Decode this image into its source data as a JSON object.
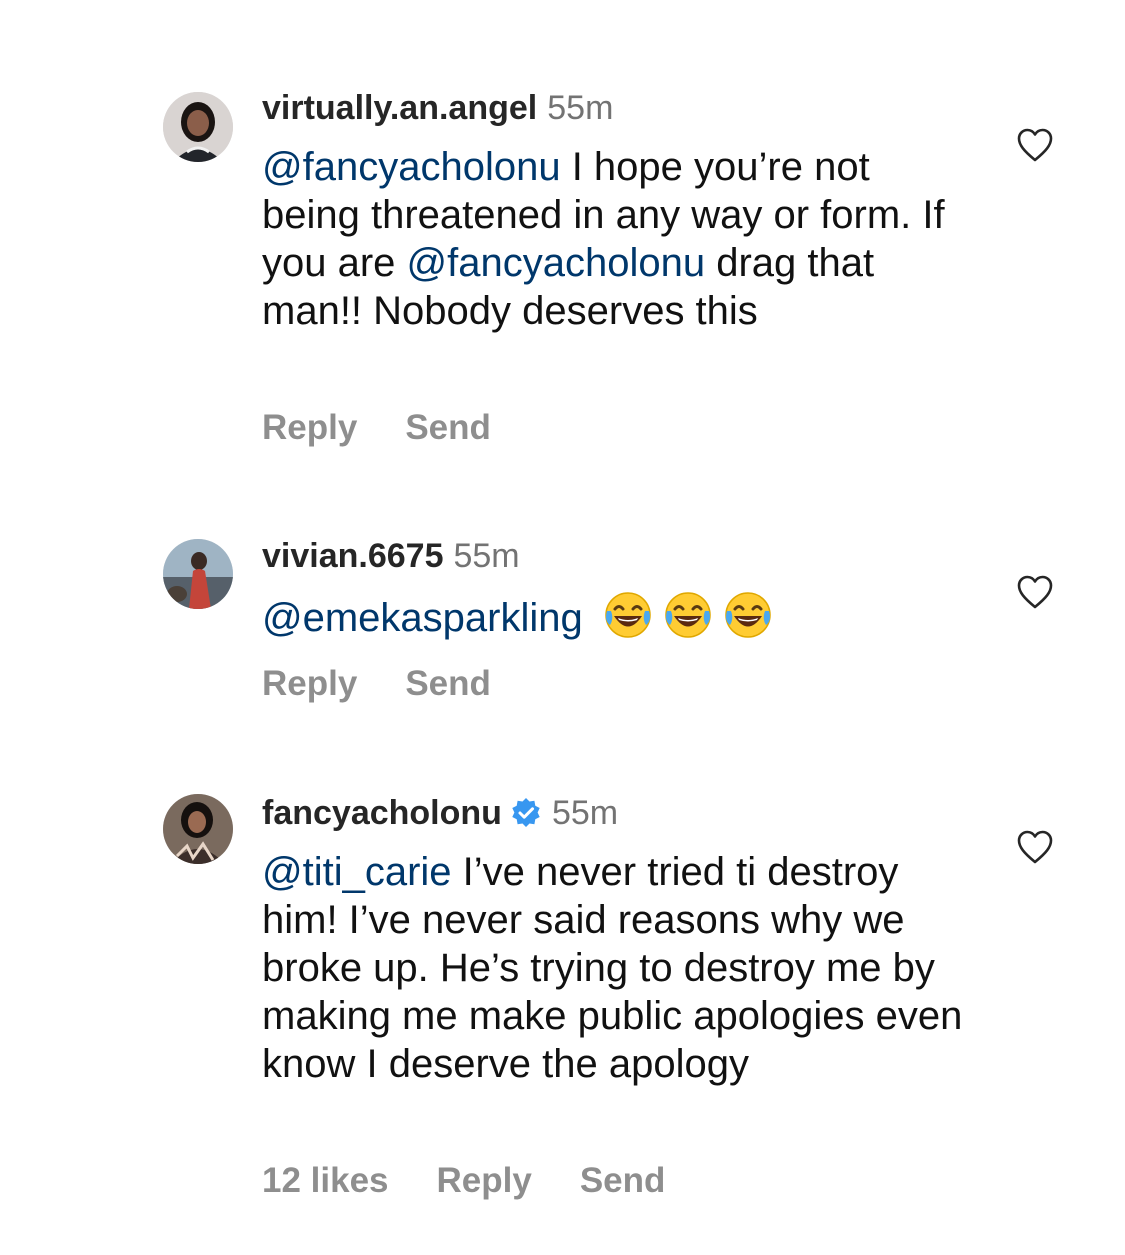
{
  "comments": [
    {
      "username": "virtually.an.angel",
      "time": "55m",
      "verified": false,
      "body": [
        {
          "t": "mention",
          "v": "@fancyacholonu"
        },
        {
          "t": "text",
          "v": " I hope you’re not being threatened in any way or form. If you are "
        },
        {
          "t": "mention",
          "v": "@fancyacholonu"
        },
        {
          "t": "text",
          "v": " drag that man!! Nobody deserves this"
        }
      ],
      "likes": "",
      "reply_label": "Reply",
      "send_label": "Send"
    },
    {
      "username": "vivian.6675",
      "time": "55m",
      "verified": false,
      "body": [
        {
          "t": "mention",
          "v": "@emekasparkling"
        },
        {
          "t": "text",
          "v": " "
        }
      ],
      "emojis": [
        "face-with-tears-of-joy",
        "face-with-tears-of-joy",
        "face-with-tears-of-joy"
      ],
      "likes": "",
      "reply_label": "Reply",
      "send_label": "Send"
    },
    {
      "username": "fancyacholonu",
      "time": "55m",
      "verified": true,
      "body": [
        {
          "t": "mention",
          "v": "@titi_carie"
        },
        {
          "t": "text",
          "v": " I’ve never tried ti destroy him! I’ve never said reasons why we broke up. He’s trying to destroy me by making me make public apologies even know I deserve the apology"
        }
      ],
      "likes": "12 likes",
      "reply_label": "Reply",
      "send_label": "Send"
    }
  ],
  "colors": {
    "mention": "#00376b",
    "meta": "#8e8e8e",
    "verified": "#3897f0"
  },
  "icons": {
    "like": "heart-outline-icon",
    "verified": "verified-badge-icon"
  }
}
